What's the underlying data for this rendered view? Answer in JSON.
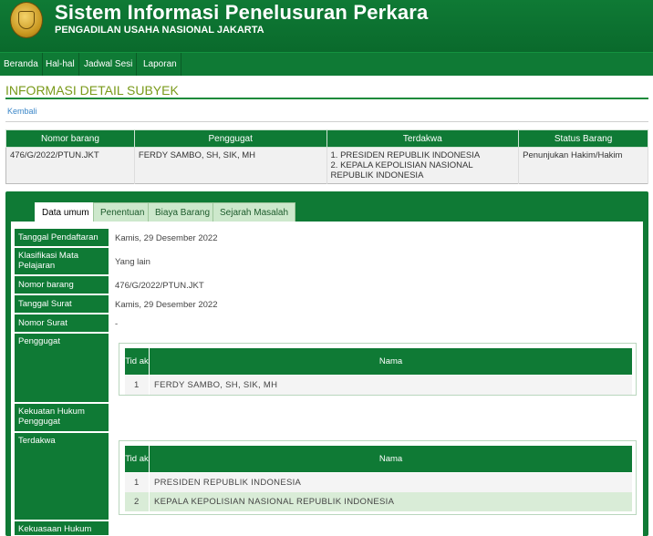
{
  "header": {
    "title": "Sistem Informasi Penelusuran Perkara",
    "subtitle": "PENGADILAN USAHA NASIONAL JAKARTA"
  },
  "nav": [
    "Beranda",
    "Hal-hal",
    "Jadwal Sesi",
    "Laporan"
  ],
  "page": {
    "title": "INFORMASI DETAIL SUBYEK",
    "back_label": "Kembali"
  },
  "summary": {
    "headers": [
      "Nomor barang",
      "Penggugat",
      "Terdakwa",
      "Status Barang"
    ],
    "row": {
      "nomor": "476/G/2022/PTUN.JKT",
      "penggugat": "FERDY SAMBO, SH, SIK, MH",
      "terdakwa_1": "1. PRESIDEN REPUBLIK INDONESIA",
      "terdakwa_2": "2. KEPALA KEPOLISIAN NASIONAL",
      "terdakwa_3": "REPUBLIK INDONESIA",
      "status": "Penunjukan Hakim/Hakim"
    }
  },
  "tabs": [
    "Data umum",
    "Penentuan",
    "Biaya Barang",
    "Sejarah Masalah"
  ],
  "detail": {
    "tanggal_pendaftaran": {
      "label": "Tanggal Pendaftaran",
      "value": "Kamis, 29 Desember 2022"
    },
    "klasifikasi": {
      "label": "Klasifikasi Mata Pelajaran",
      "value": "Yang lain"
    },
    "nomor_barang": {
      "label": "Nomor barang",
      "value": "476/G/2022/PTUN.JKT"
    },
    "tanggal_surat": {
      "label": "Tanggal Surat",
      "value": "Kamis, 29 Desember 2022"
    },
    "nomor_surat": {
      "label": "Nomor Surat",
      "value": "-"
    },
    "penggugat": {
      "label": "Penggugat",
      "col_num": "Tid ak",
      "col_name": "Nama",
      "rows": [
        {
          "num": "1",
          "name": "FERDY SAMBO, SH, SIK, MH"
        }
      ]
    },
    "kekuatan_hukum": {
      "label": "Kekuatan Hukum Penggugat"
    },
    "terdakwa": {
      "label": "Terdakwa",
      "col_num": "Tid ak",
      "col_name": "Nama",
      "rows": [
        {
          "num": "1",
          "name": "PRESIDEN REPUBLIK INDONESIA"
        },
        {
          "num": "2",
          "name": "KEPALA KEPOLISIAN NASIONAL REPUBLIK INDONESIA"
        }
      ]
    },
    "kekuasaan_hukum": {
      "label": "Kekuasaan Hukum"
    }
  },
  "colors": {
    "brand_green": "#0f7a35",
    "title_olive": "#7a9a1a",
    "link_blue": "#3a86c8"
  },
  "icons": {
    "logo": "court-emblem-icon"
  }
}
